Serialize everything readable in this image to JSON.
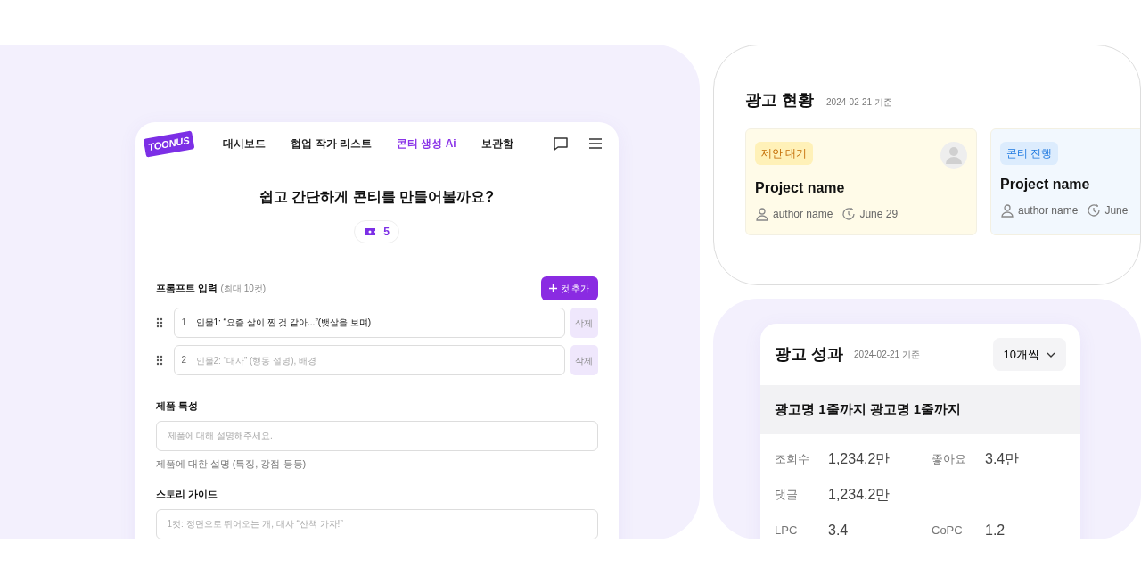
{
  "app": {
    "logo": "TOONUS",
    "nav": [
      {
        "label": "대시보드",
        "selected": false
      },
      {
        "label": "협업 작가 리스트",
        "selected": false
      },
      {
        "label": "콘티 생성 Ai",
        "selected": true
      },
      {
        "label": "보관함",
        "selected": false
      }
    ],
    "heading": "쉽고 간단하게 콘티를 만들어볼까요?",
    "credits": "5",
    "prompt": {
      "label": "프롬프트 입력",
      "hint": "(최대 10컷)",
      "add_button": "컷 추가",
      "cuts": [
        {
          "number": "1",
          "value": "인물1: “요즘 살이 찐 것 같아...”(뱃살을 보며)",
          "delete_button": "삭제"
        },
        {
          "number": "2",
          "placeholder": "인물2: “대사” (행동 설명), 배경",
          "delete_button": "삭제"
        }
      ]
    },
    "product": {
      "label": "제품 특성",
      "placeholder": "제품에 대해 설명해주세요.",
      "help": "제품에 대한 설명 (특징, 강점 등등)"
    },
    "story": {
      "label": "스토리 가이드",
      "placeholder": "1컷: 정면으로 뛰어오는 개, 대사 “산책 가자!”"
    }
  },
  "ad_status": {
    "title": "광고 현황",
    "date": "2024-02-21 기준",
    "cards": [
      {
        "kind": "pending",
        "status": "제안 대기",
        "avatar": true,
        "name": "Project name",
        "author": "author name",
        "date": "June 29"
      },
      {
        "kind": "progress",
        "status": "콘티 진행",
        "avatar": false,
        "name": "Project name",
        "author": "author name",
        "date": "June"
      }
    ]
  },
  "ad_performance": {
    "title": "광고 성과",
    "date": "2024-02-21 기준",
    "page_size": "10개씩",
    "ad_name": "광고명 1줄까지 광고명 1줄까지",
    "metric_rows": [
      [
        {
          "label": "조회수",
          "value": "1,234.2만"
        },
        {
          "label": "좋아요",
          "value": "3.4만"
        }
      ],
      [
        {
          "label": "댓글",
          "value": "1,234.2만"
        }
      ],
      [
        {
          "label": "LPC",
          "value": "3.4"
        },
        {
          "label": "CoPC",
          "value": "1.2"
        }
      ]
    ]
  }
}
